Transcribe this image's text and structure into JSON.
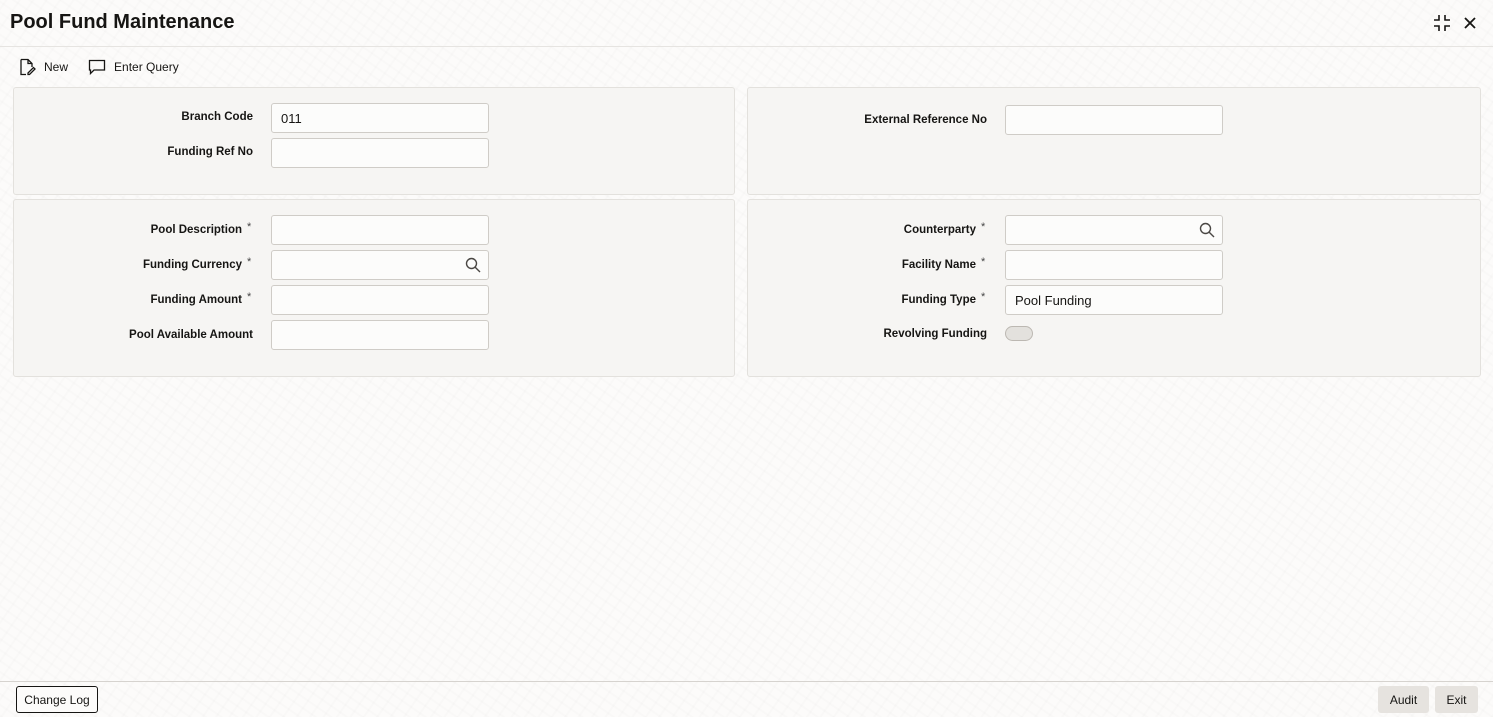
{
  "window": {
    "title": "Pool Fund Maintenance",
    "icons": {
      "minimize": "compress-icon",
      "close": "close-icon"
    }
  },
  "toolbar": {
    "new_label": "New",
    "enter_query_label": "Enter Query"
  },
  "header_left": {
    "branch_code_label": "Branch Code",
    "branch_code_value": "011",
    "funding_ref_no_label": "Funding Ref No",
    "funding_ref_no_value": ""
  },
  "header_right": {
    "external_reference_no_label": "External Reference No",
    "external_reference_no_value": ""
  },
  "details_left": {
    "pool_description_label": "Pool Description",
    "pool_description_value": "",
    "funding_currency_label": "Funding Currency",
    "funding_currency_value": "",
    "funding_amount_label": "Funding Amount",
    "funding_amount_value": "",
    "pool_available_amount_label": "Pool Available Amount",
    "pool_available_amount_value": ""
  },
  "details_right": {
    "counterparty_label": "Counterparty",
    "counterparty_value": "",
    "facility_name_label": "Facility Name",
    "facility_name_value": "",
    "funding_type_label": "Funding Type",
    "funding_type_value": "Pool Funding",
    "revolving_funding_label": "Revolving Funding",
    "revolving_funding_on": false
  },
  "required_marker": "*",
  "footer": {
    "change_log_label": "Change Log",
    "audit_label": "Audit",
    "exit_label": "Exit"
  }
}
